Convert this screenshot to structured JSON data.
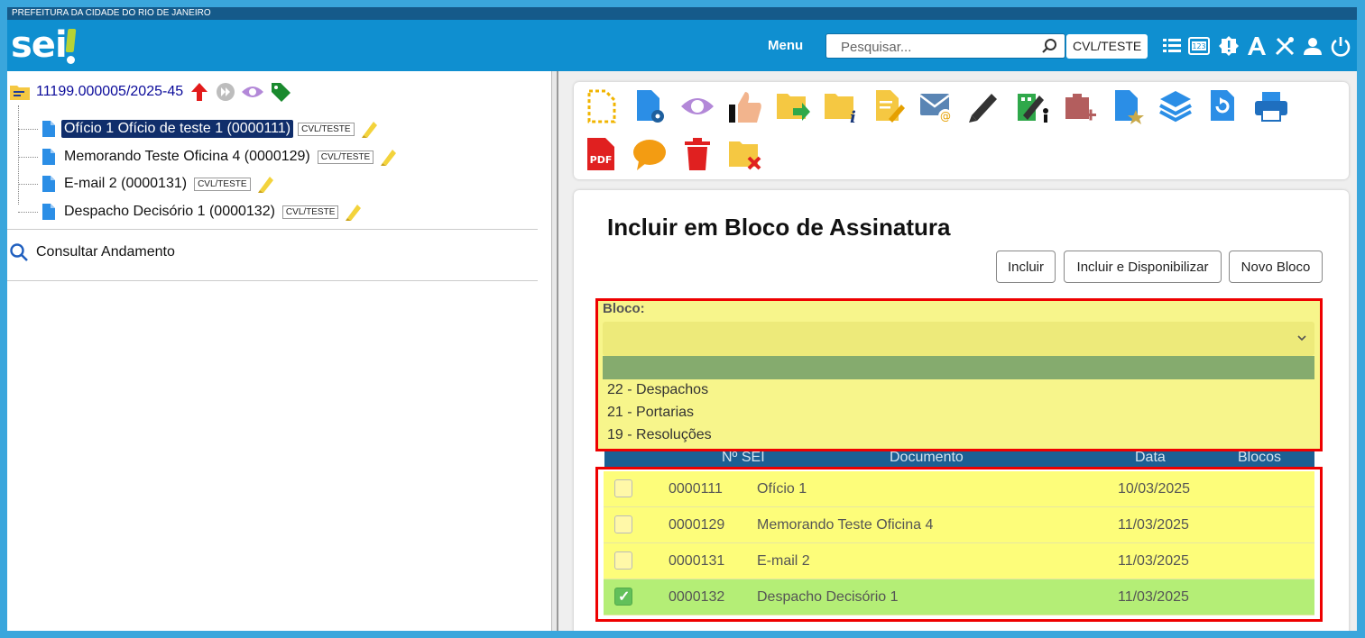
{
  "header": {
    "org": "PREFEITURA DA CIDADE DO RIO DE JANEIRO",
    "logo": "sei",
    "menu_label": "Menu",
    "search_placeholder": "Pesquisar...",
    "unit": "CVL/TESTE",
    "icons": [
      "list-icon",
      "numbered-icon",
      "alert-icon",
      "font-icon",
      "tools-icon",
      "user-icon",
      "power-icon"
    ]
  },
  "tree": {
    "process": "11199.000005/2025-45",
    "documents": [
      {
        "label": "Ofício 1 Ofício de teste 1 (0000111)",
        "unit": "CVL/TESTE",
        "selected": true
      },
      {
        "label": "Memorando Teste Oficina 4 (0000129)",
        "unit": "CVL/TESTE",
        "selected": false
      },
      {
        "label": "E-mail 2 (0000131)",
        "unit": "CVL/TESTE",
        "selected": false
      },
      {
        "label": "Despacho Decisório 1 (0000132)",
        "unit": "CVL/TESTE",
        "selected": false
      }
    ],
    "consult": "Consultar Andamento"
  },
  "form": {
    "title": "Incluir em Bloco de Assinatura",
    "buttons": {
      "incluir": "Incluir",
      "incluir_disp": "Incluir e Disponibilizar",
      "novo": "Novo Bloco"
    },
    "bloco_label": "Bloco:",
    "options": [
      "22 - Despachos",
      "21 - Portarias",
      "19 - Resoluções"
    ],
    "table": {
      "headers": {
        "num": "Nº SEI",
        "doc": "Documento",
        "data": "Data",
        "blocos": "Blocos"
      },
      "rows": [
        {
          "num": "0000111",
          "doc": "Ofício 1",
          "date": "10/03/2025",
          "checked": false
        },
        {
          "num": "0000129",
          "doc": "Memorando Teste Oficina 4",
          "date": "11/03/2025",
          "checked": false
        },
        {
          "num": "0000131",
          "doc": "E-mail 2",
          "date": "11/03/2025",
          "checked": false
        },
        {
          "num": "0000132",
          "doc": "Despacho Decisório 1",
          "date": "11/03/2025",
          "checked": true
        }
      ]
    }
  },
  "colors": {
    "header": "#0f8fd0",
    "highlight": "#fdfd7a",
    "checked_row": "#b4ee76",
    "outline": "#e00000"
  }
}
